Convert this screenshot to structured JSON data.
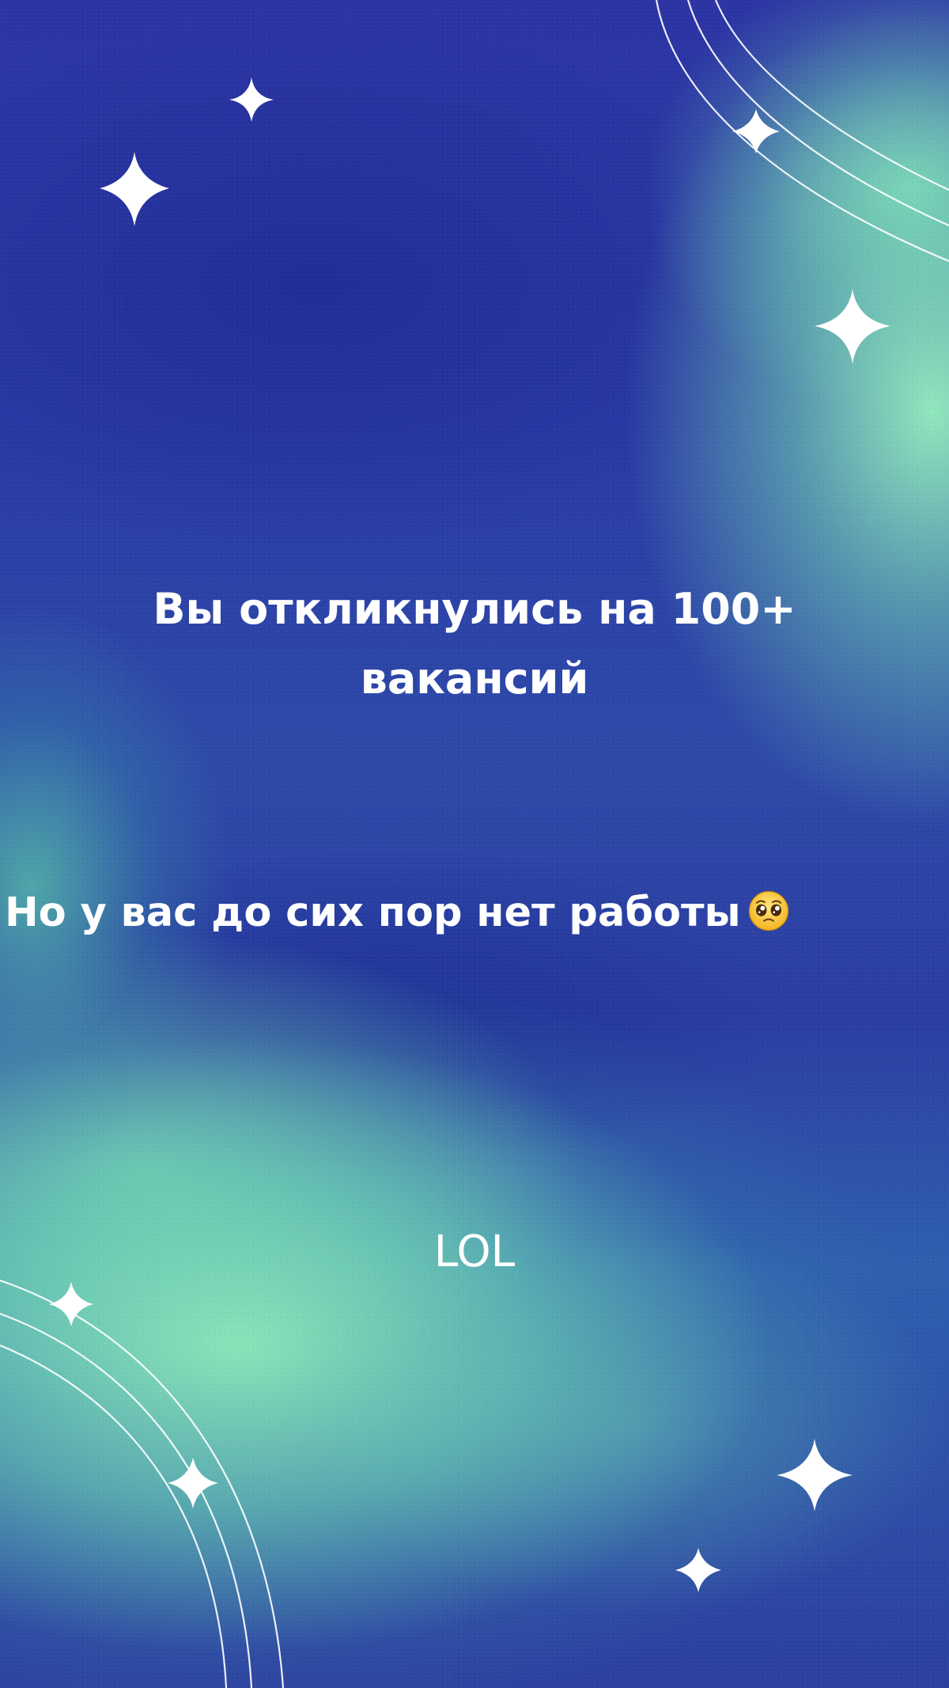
{
  "slide": {
    "headline": "Вы откликнулись на 100+ вакансий",
    "subline": "Но у вас до сих пор нет работы",
    "subline_emoji": "pleading-face-emoji",
    "footer": "LOL"
  },
  "colors": {
    "background_blue": "#2a2f9c",
    "glow_green": "#96f0be",
    "text": "#ffffff"
  },
  "icons": [
    "sparkle-icon",
    "orbit-lines",
    "pleading-face-emoji"
  ]
}
